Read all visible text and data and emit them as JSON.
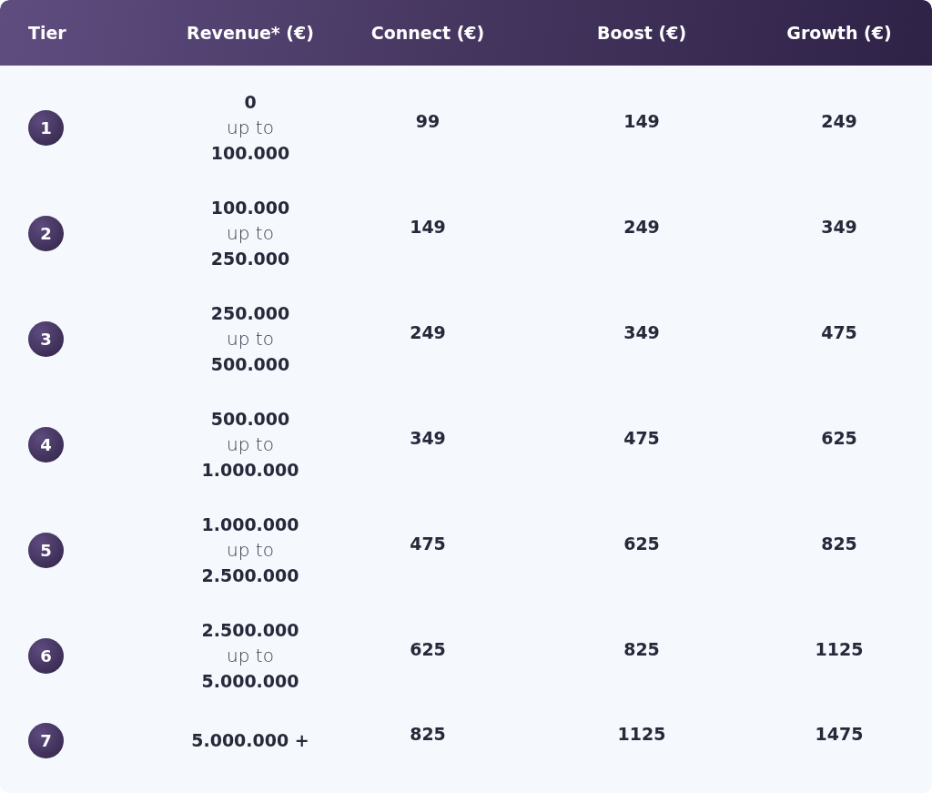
{
  "table": {
    "columns": [
      "Tier",
      "Revenue* (€)",
      "Connect (€)",
      "Boost (€)",
      "Growth (€)"
    ],
    "rows": [
      {
        "tier": "1",
        "revenue": {
          "kind": "range",
          "from": "0",
          "sep": "up to",
          "to": "100.000"
        },
        "connect": "99",
        "boost": "149",
        "growth": "249"
      },
      {
        "tier": "2",
        "revenue": {
          "kind": "range",
          "from": "100.000",
          "sep": "up to",
          "to": "250.000"
        },
        "connect": "149",
        "boost": "249",
        "growth": "349"
      },
      {
        "tier": "3",
        "revenue": {
          "kind": "range",
          "from": "250.000",
          "sep": "up to",
          "to": "500.000"
        },
        "connect": "249",
        "boost": "349",
        "growth": "475"
      },
      {
        "tier": "4",
        "revenue": {
          "kind": "range",
          "from": "500.000",
          "sep": "up to",
          "to": "1.000.000"
        },
        "connect": "349",
        "boost": "475",
        "growth": "625"
      },
      {
        "tier": "5",
        "revenue": {
          "kind": "range",
          "from": "1.000.000",
          "sep": "up to",
          "to": "2.500.000"
        },
        "connect": "475",
        "boost": "625",
        "growth": "825"
      },
      {
        "tier": "6",
        "revenue": {
          "kind": "range",
          "from": "2.500.000",
          "sep": "up to",
          "to": "5.000.000"
        },
        "connect": "625",
        "boost": "825",
        "growth": "1125"
      },
      {
        "tier": "7",
        "revenue": {
          "kind": "open",
          "text": "5.000.000 +"
        },
        "connect": "825",
        "boost": "1125",
        "growth": "1475"
      }
    ]
  }
}
